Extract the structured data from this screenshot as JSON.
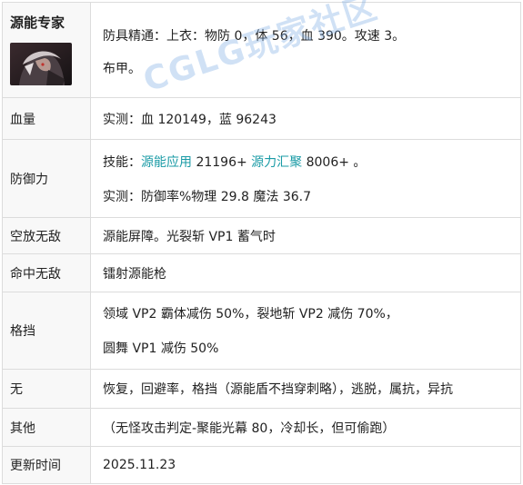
{
  "header": {
    "name": "源能专家",
    "lines": [
      "防具精通：上衣：物防 0，体 56，血 390。攻速 3。",
      "布甲。"
    ]
  },
  "rows": {
    "hp": {
      "label": "血量",
      "text": "实测：血 120149，蓝 96243"
    },
    "defense": {
      "label": "防御力",
      "skill_prefix": "技能：",
      "skill1": "源能应用",
      "skill1_value": " 21196+ ",
      "skill2": "源力汇聚",
      "skill2_value": " 8006+ 。",
      "measured": "实测：防御率%物理 29.8 魔法 36.7"
    },
    "air_invincible": {
      "label": "空放无敌",
      "text": "源能屏障。光裂斩 VP1 蓄气时"
    },
    "hit_invincible": {
      "label": "命中无敌",
      "text": "镭射源能枪"
    },
    "block": {
      "label": "格挡",
      "line1": "领域 VP2 霸体减伤 50%，裂地斩 VP2 减伤 70%，",
      "line2": "圆舞 VP1 减伤 50%"
    },
    "none": {
      "label": "无",
      "text": "恢复，回避率，格挡（源能盾不挡穿刺略），逃脱，属抗，异抗"
    },
    "other": {
      "label": "其他",
      "text": "（无怪攻击判定-聚能光幕 80，冷却长，但可偷跑）"
    },
    "updated": {
      "label": "更新时间",
      "text": "2025.11.23"
    }
  },
  "watermark": "CGLG玩家社区",
  "colors": {
    "highlight": "#1a9ba6",
    "border": "#dcdcdc"
  }
}
